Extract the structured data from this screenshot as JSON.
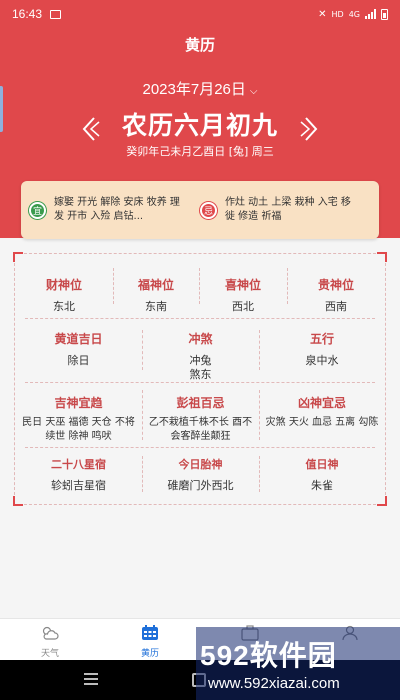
{
  "status": {
    "time": "16:43",
    "network": "HD",
    "signal": "4G"
  },
  "app": {
    "title": "黄历"
  },
  "date": {
    "solar": "2023年7月26日",
    "lunar": "农历六月初九",
    "ganzhi": "癸卯年己未月乙酉日 [兔] 周三"
  },
  "yiji": {
    "yi_badge": "宜",
    "ji_badge": "忌",
    "yi": "嫁娶 开光 解除 安床 牧养 理发 开市 入殓 启钻...",
    "ji": "作灶 动土 上梁 栽种 入宅 移徙 修造 祈福"
  },
  "row1": [
    {
      "title": "财神位",
      "value": "东北"
    },
    {
      "title": "福神位",
      "value": "东南"
    },
    {
      "title": "喜神位",
      "value": "西北"
    },
    {
      "title": "贵神位",
      "value": "西南"
    }
  ],
  "row2": [
    {
      "title": "黄道吉日",
      "value": "除日"
    },
    {
      "title": "冲煞",
      "value": "冲兔\n煞东"
    },
    {
      "title": "五行",
      "value": "泉中水"
    }
  ],
  "row3": [
    {
      "title": "吉神宜趋",
      "value": "民日 天巫 福德 天仓 不将 续世 除神 鸣吠"
    },
    {
      "title": "彭祖百忌",
      "value": "乙不栽植千株不长 酉不会客醉坐颠狂"
    },
    {
      "title": "凶神宜忌",
      "value": "灾煞 天火 血忌 五离 勾陈"
    }
  ],
  "row4": [
    {
      "title": "二十八星宿",
      "value": "轸蚓吉星宿"
    },
    {
      "title": "今日胎神",
      "value": "碓磨门外西北"
    },
    {
      "title": "值日神",
      "value": "朱雀"
    }
  ],
  "bottom_nav": {
    "weather": "天气",
    "almanac": "黄历"
  },
  "watermark": {
    "main": "592软件园",
    "url": "www.592xiazai.com"
  },
  "colors": {
    "primary_red": "#e0484b",
    "accent_blue": "#1e6fd9",
    "card": "#f9e1c4"
  }
}
